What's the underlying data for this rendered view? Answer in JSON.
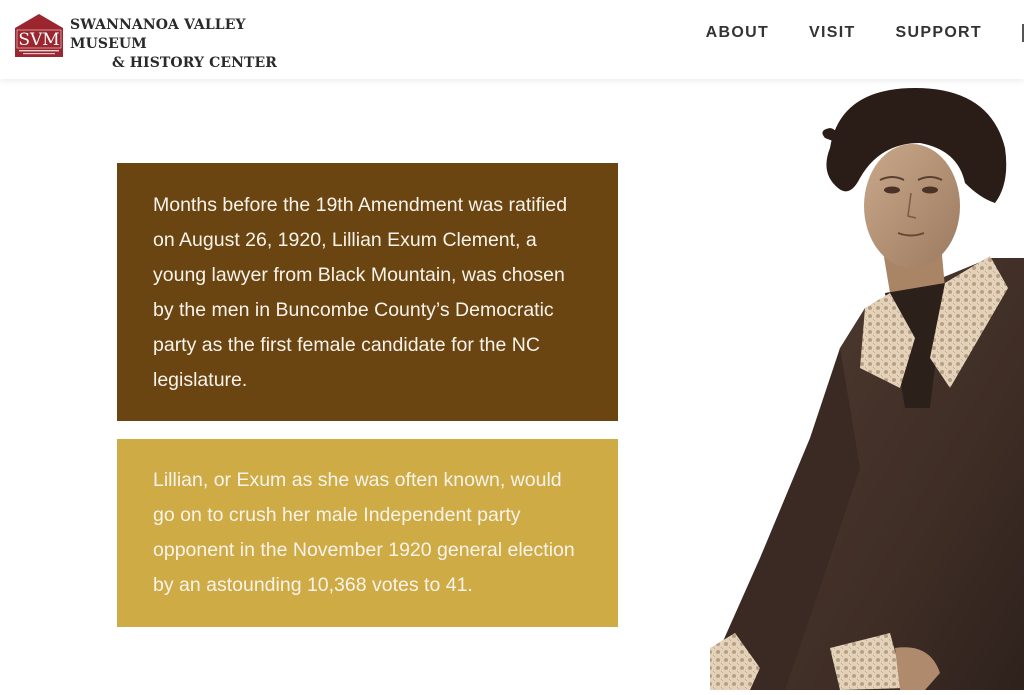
{
  "brand": {
    "logo_initials": "SVM",
    "name_line1": "SWANNANOA VALLEY MUSEUM",
    "name_line2": "& HISTORY CENTER"
  },
  "nav": {
    "items": [
      "ABOUT",
      "VISIT",
      "SUPPORT"
    ]
  },
  "story": {
    "paragraph1": "Months before the 19th Amendment was ratified on August 26, 1920, Lillian Exum Clement, a young lawyer from Black Mountain, was chosen by the men in Buncombe County’s Democratic party as the first female candidate for the NC legislature.",
    "paragraph2": "Lillian, or Exum as she was often known, would go on to crush her male Independent party opponent in the November 1920 general election by an astounding 10,368 votes to 41."
  },
  "colors": {
    "box1_bg": "#6b4511",
    "box2_bg": "#ceab45",
    "logo_red": "#9b2630"
  },
  "portrait": {
    "icon": "portrait-photo"
  }
}
